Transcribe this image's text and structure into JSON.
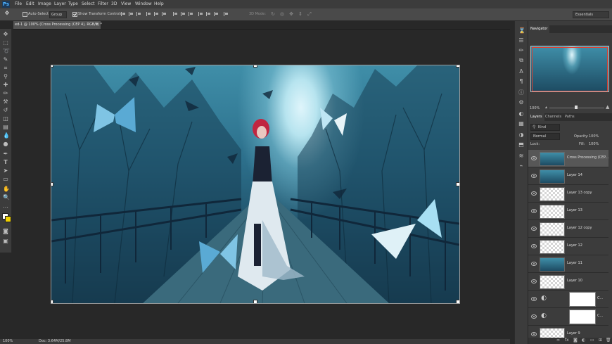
{
  "menubar": {
    "logo": "Ps",
    "items": [
      "File",
      "Edit",
      "Image",
      "Layer",
      "Type",
      "Select",
      "Filter",
      "3D",
      "View",
      "Window",
      "Help"
    ]
  },
  "options": {
    "auto_select_label": "Auto-Select",
    "auto_select_value": "Group",
    "show_transform_label": "Show Transform Controls",
    "mode_3d": "3D Mode:",
    "workspace": "Essentials"
  },
  "document": {
    "tab_title": "ed-1 @ 100% (Cross Processing (CEP 4), RGB/8) *",
    "close": "×",
    "zoom": "100%",
    "doc_size": "Doc: 3.64M/25.8M"
  },
  "navigator": {
    "tab": "Navigator",
    "zoom": "100%"
  },
  "layers_panel": {
    "tabs": [
      "Layers",
      "Channels",
      "Paths"
    ],
    "filter_kind": "Kind",
    "blend_mode": "Normal",
    "opacity_label": "Opacity:",
    "opacity_value": "100%",
    "lock_label": "Lock:",
    "fill_label": "Fill:",
    "fill_value": "100%",
    "layers": [
      {
        "name": "Cross Processing (CEP...",
        "thumb": "img"
      },
      {
        "name": "Layer 14",
        "thumb": "img"
      },
      {
        "name": "Layer 13 copy",
        "thumb": "trans"
      },
      {
        "name": "Layer 13",
        "thumb": "trans"
      },
      {
        "name": "Layer 12 copy",
        "thumb": "trans"
      },
      {
        "name": "Layer 12",
        "thumb": "trans"
      },
      {
        "name": "Layer 11",
        "thumb": "img"
      },
      {
        "name": "Layer 10",
        "thumb": "trans"
      },
      {
        "name": "C...",
        "thumb": "adjustment"
      },
      {
        "name": "C...",
        "thumb": "adjustment"
      },
      {
        "name": "Layer 9",
        "thumb": "trans"
      }
    ]
  },
  "icons": {
    "move": "move-icon",
    "eye": "eye-icon",
    "zoom": "zoom-icon",
    "hand": "hand-icon",
    "type": "type-icon"
  }
}
